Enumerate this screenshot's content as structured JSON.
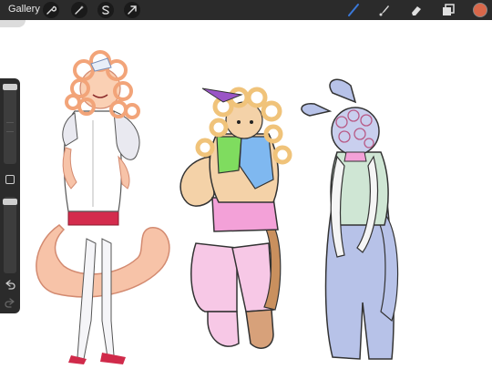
{
  "topbar": {
    "gallery_label": "Gallery",
    "left_tools": [
      "wrench-icon",
      "magic-wand-icon",
      "selection-s-icon",
      "transform-arrow-icon"
    ],
    "right_tools": [
      "brush-icon",
      "smudge-icon",
      "eraser-icon",
      "layers-icon"
    ],
    "current_color": "#d8674a"
  },
  "sidebar": {
    "controls": [
      "brush-size-slider",
      "modify-square-button",
      "opacity-slider",
      "undo-icon",
      "redo-icon"
    ]
  },
  "colors": {
    "ui_dark": "#2b2b2b",
    "brush_active": "#3a78d8",
    "peach": "#f7c8a9",
    "curl": "#f2b48a",
    "blue_denim": "#b7c2e8",
    "mint": "#cfe6d4",
    "pink": "#f7b7e4",
    "green": "#7fdc5f",
    "sky": "#7fb8f0",
    "purple": "#9a55c7"
  }
}
